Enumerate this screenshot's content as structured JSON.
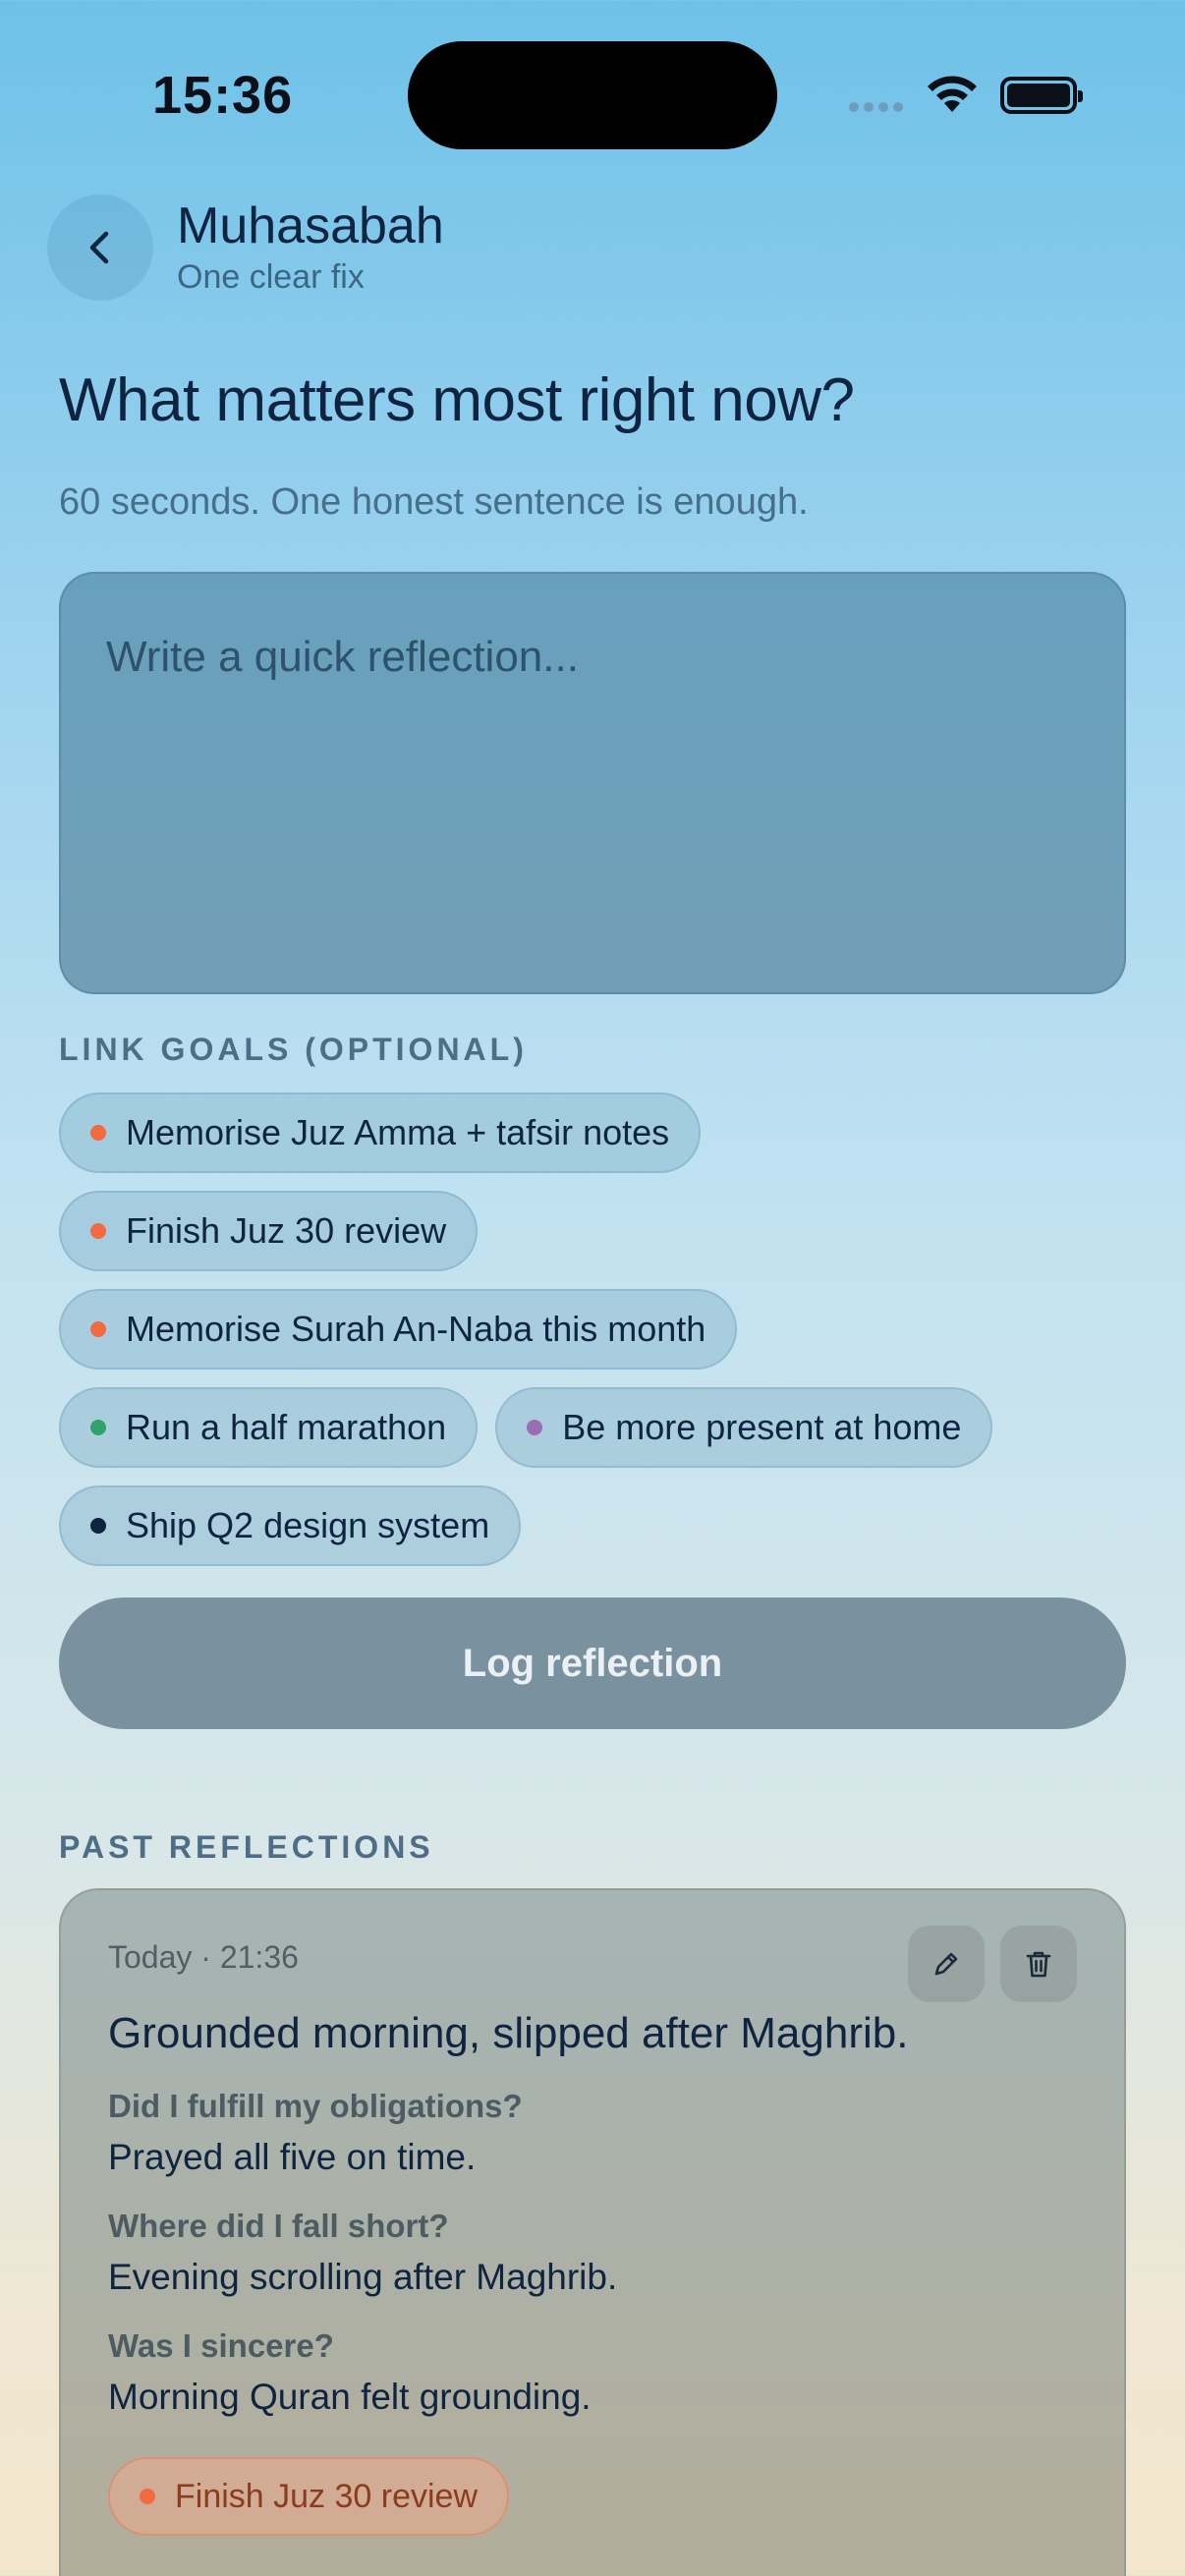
{
  "status_bar": {
    "time": "15:36"
  },
  "header": {
    "title": "Muhasabah",
    "subtitle": "One clear fix"
  },
  "prompt": {
    "question": "What matters most right now?",
    "hint": "60 seconds. One honest sentence is enough.",
    "input_placeholder": "Write a quick reflection...",
    "input_value": ""
  },
  "goals": {
    "label": "LINK GOALS (OPTIONAL)",
    "items": [
      {
        "label": "Memorise Juz Amma + tafsir notes",
        "color": "#f26a3f"
      },
      {
        "label": "Finish Juz 30 review",
        "color": "#f26a3f"
      },
      {
        "label": "Memorise Surah An-Naba this month",
        "color": "#f26a3f"
      },
      {
        "label": "Run a half marathon",
        "color": "#2fa36b"
      },
      {
        "label": "Be more present at home",
        "color": "#9a6db3"
      },
      {
        "label": "Ship Q2 design system",
        "color": "#0f2440"
      }
    ]
  },
  "log_button": "Log reflection",
  "past": {
    "label": "PAST REFLECTIONS",
    "entries": [
      {
        "date": "Today · 21:36",
        "title": "Grounded morning, slipped after Maghrib.",
        "qa": [
          {
            "q": "Did I fulfill my obligations?",
            "a": "Prayed all five on time."
          },
          {
            "q": "Where did I fall short?",
            "a": "Evening scrolling after Maghrib."
          },
          {
            "q": "Was I sincere?",
            "a": "Morning Quran felt grounding."
          }
        ],
        "tag": {
          "label": "Finish Juz 30 review",
          "color": "#f26a3f"
        }
      }
    ]
  }
}
